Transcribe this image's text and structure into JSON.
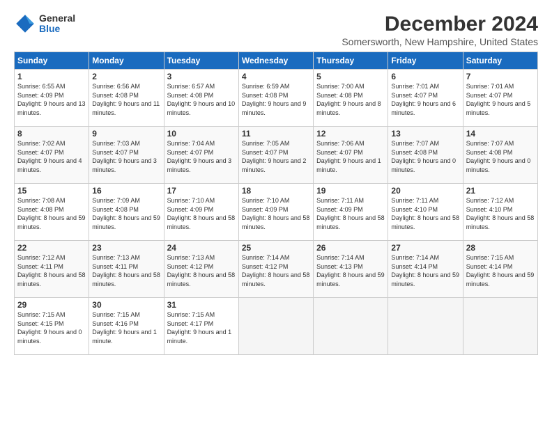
{
  "logo": {
    "general": "General",
    "blue": "Blue"
  },
  "title": "December 2024",
  "location": "Somersworth, New Hampshire, United States",
  "days_of_week": [
    "Sunday",
    "Monday",
    "Tuesday",
    "Wednesday",
    "Thursday",
    "Friday",
    "Saturday"
  ],
  "weeks": [
    [
      {
        "day": "1",
        "sunrise": "6:55 AM",
        "sunset": "4:09 PM",
        "daylight": "9 hours and 13 minutes."
      },
      {
        "day": "2",
        "sunrise": "6:56 AM",
        "sunset": "4:08 PM",
        "daylight": "9 hours and 11 minutes."
      },
      {
        "day": "3",
        "sunrise": "6:57 AM",
        "sunset": "4:08 PM",
        "daylight": "9 hours and 10 minutes."
      },
      {
        "day": "4",
        "sunrise": "6:59 AM",
        "sunset": "4:08 PM",
        "daylight": "9 hours and 9 minutes."
      },
      {
        "day": "5",
        "sunrise": "7:00 AM",
        "sunset": "4:08 PM",
        "daylight": "9 hours and 8 minutes."
      },
      {
        "day": "6",
        "sunrise": "7:01 AM",
        "sunset": "4:07 PM",
        "daylight": "9 hours and 6 minutes."
      },
      {
        "day": "7",
        "sunrise": "7:01 AM",
        "sunset": "4:07 PM",
        "daylight": "9 hours and 5 minutes."
      }
    ],
    [
      {
        "day": "8",
        "sunrise": "7:02 AM",
        "sunset": "4:07 PM",
        "daylight": "9 hours and 4 minutes."
      },
      {
        "day": "9",
        "sunrise": "7:03 AM",
        "sunset": "4:07 PM",
        "daylight": "9 hours and 3 minutes."
      },
      {
        "day": "10",
        "sunrise": "7:04 AM",
        "sunset": "4:07 PM",
        "daylight": "9 hours and 3 minutes."
      },
      {
        "day": "11",
        "sunrise": "7:05 AM",
        "sunset": "4:07 PM",
        "daylight": "9 hours and 2 minutes."
      },
      {
        "day": "12",
        "sunrise": "7:06 AM",
        "sunset": "4:07 PM",
        "daylight": "9 hours and 1 minute."
      },
      {
        "day": "13",
        "sunrise": "7:07 AM",
        "sunset": "4:08 PM",
        "daylight": "9 hours and 0 minutes."
      },
      {
        "day": "14",
        "sunrise": "7:07 AM",
        "sunset": "4:08 PM",
        "daylight": "9 hours and 0 minutes."
      }
    ],
    [
      {
        "day": "15",
        "sunrise": "7:08 AM",
        "sunset": "4:08 PM",
        "daylight": "8 hours and 59 minutes."
      },
      {
        "day": "16",
        "sunrise": "7:09 AM",
        "sunset": "4:08 PM",
        "daylight": "8 hours and 59 minutes."
      },
      {
        "day": "17",
        "sunrise": "7:10 AM",
        "sunset": "4:09 PM",
        "daylight": "8 hours and 58 minutes."
      },
      {
        "day": "18",
        "sunrise": "7:10 AM",
        "sunset": "4:09 PM",
        "daylight": "8 hours and 58 minutes."
      },
      {
        "day": "19",
        "sunrise": "7:11 AM",
        "sunset": "4:09 PM",
        "daylight": "8 hours and 58 minutes."
      },
      {
        "day": "20",
        "sunrise": "7:11 AM",
        "sunset": "4:10 PM",
        "daylight": "8 hours and 58 minutes."
      },
      {
        "day": "21",
        "sunrise": "7:12 AM",
        "sunset": "4:10 PM",
        "daylight": "8 hours and 58 minutes."
      }
    ],
    [
      {
        "day": "22",
        "sunrise": "7:12 AM",
        "sunset": "4:11 PM",
        "daylight": "8 hours and 58 minutes."
      },
      {
        "day": "23",
        "sunrise": "7:13 AM",
        "sunset": "4:11 PM",
        "daylight": "8 hours and 58 minutes."
      },
      {
        "day": "24",
        "sunrise": "7:13 AM",
        "sunset": "4:12 PM",
        "daylight": "8 hours and 58 minutes."
      },
      {
        "day": "25",
        "sunrise": "7:14 AM",
        "sunset": "4:12 PM",
        "daylight": "8 hours and 58 minutes."
      },
      {
        "day": "26",
        "sunrise": "7:14 AM",
        "sunset": "4:13 PM",
        "daylight": "8 hours and 59 minutes."
      },
      {
        "day": "27",
        "sunrise": "7:14 AM",
        "sunset": "4:14 PM",
        "daylight": "8 hours and 59 minutes."
      },
      {
        "day": "28",
        "sunrise": "7:15 AM",
        "sunset": "4:14 PM",
        "daylight": "8 hours and 59 minutes."
      }
    ],
    [
      {
        "day": "29",
        "sunrise": "7:15 AM",
        "sunset": "4:15 PM",
        "daylight": "9 hours and 0 minutes."
      },
      {
        "day": "30",
        "sunrise": "7:15 AM",
        "sunset": "4:16 PM",
        "daylight": "9 hours and 1 minute."
      },
      {
        "day": "31",
        "sunrise": "7:15 AM",
        "sunset": "4:17 PM",
        "daylight": "9 hours and 1 minute."
      },
      null,
      null,
      null,
      null
    ]
  ]
}
